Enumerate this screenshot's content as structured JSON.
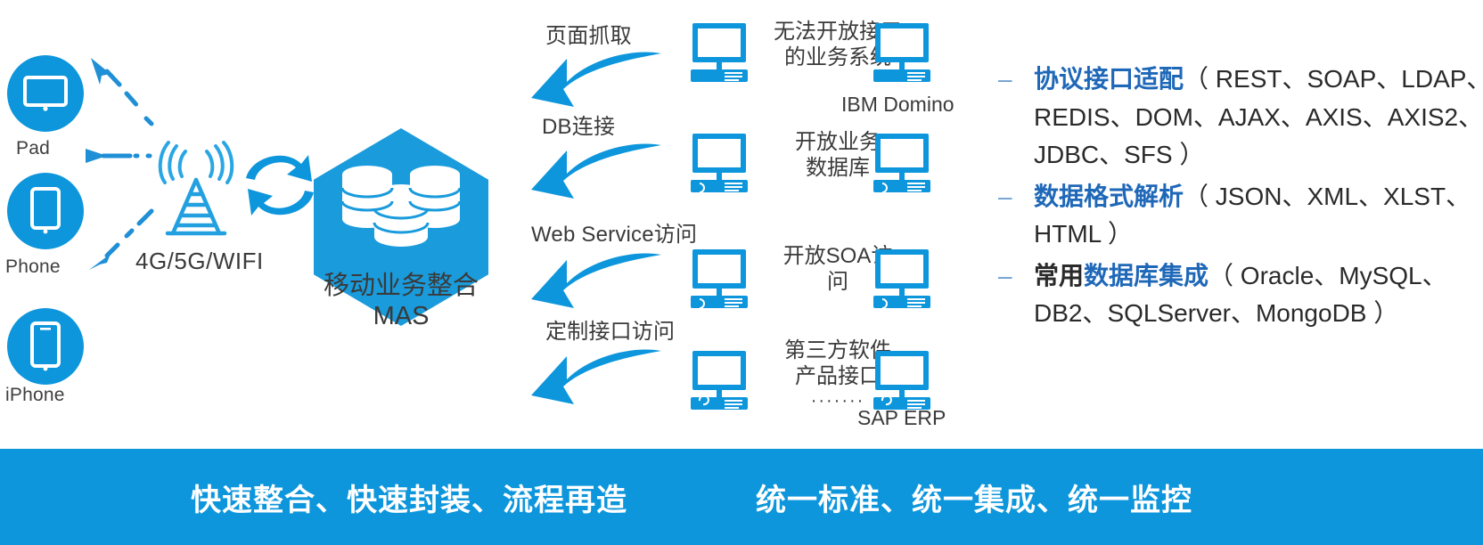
{
  "devices": [
    {
      "label": "Pad",
      "icon": "tablet-icon"
    },
    {
      "label": "Phone",
      "icon": "smartphone-icon"
    },
    {
      "label": "iPhone",
      "icon": "iphone-icon"
    }
  ],
  "network": {
    "label": "4G/5G/WIFI",
    "tower_icon": "antenna-tower-icon",
    "sync_icon": "exchange-arrows-icon"
  },
  "hub": {
    "icon": "database-stack-icon",
    "label": "移动业务整合\nMAS"
  },
  "channels": [
    {
      "label": "页面抓取",
      "arrow": "curved-arrow-left-icon"
    },
    {
      "label": "DB连接",
      "arrow": "curved-arrow-left-icon"
    },
    {
      "label": "Web Service访问",
      "arrow": "curved-arrow-left-icon"
    },
    {
      "label": "定制接口访问",
      "arrow": "curved-arrow-left-icon"
    }
  ],
  "systems": [
    {
      "label": "无法开放接口\n的业务系统",
      "dots": "",
      "brand": "IBM Domino"
    },
    {
      "label": "开放业务\n数据库",
      "dots": "",
      "brand": ""
    },
    {
      "label": "开放SOA访\n问",
      "dots": "",
      "brand": ""
    },
    {
      "label": "第三方软件\n产品接口",
      "dots": "·······",
      "brand": "SAP ERP"
    }
  ],
  "capabilities": [
    {
      "dash": "–",
      "head": "协议接口适配",
      "head_color": "blue",
      "lines": [
        "（ REST、SOAP、LDAP、",
        "REDIS、DOM、AJAX、AXIS、AXIS2、",
        "JDBC、SFS ）"
      ]
    },
    {
      "dash": "–",
      "head": "数据格式解析",
      "head_color": "blue",
      "lines": [
        "（ JSON、XML、XLST、",
        "HTML ）"
      ]
    },
    {
      "dash": "–",
      "head_prefix": "常用",
      "head": "数据库集成",
      "head_color": "blue",
      "lines": [
        "（ Oracle、MySQL、",
        "DB2、SQLServer、MongoDB ）"
      ]
    }
  ],
  "banner": {
    "left_text": "快速整合、快速封装、流程再造",
    "right_text": "统一标准、统一集成、统一监控"
  },
  "colors": {
    "brand_blue": "#0d96dc",
    "hex_blue": "#1a9bdc",
    "heading_blue": "#1f68b8",
    "banner_blue": "#0d96dc",
    "text_dark": "#3a3a3a"
  }
}
